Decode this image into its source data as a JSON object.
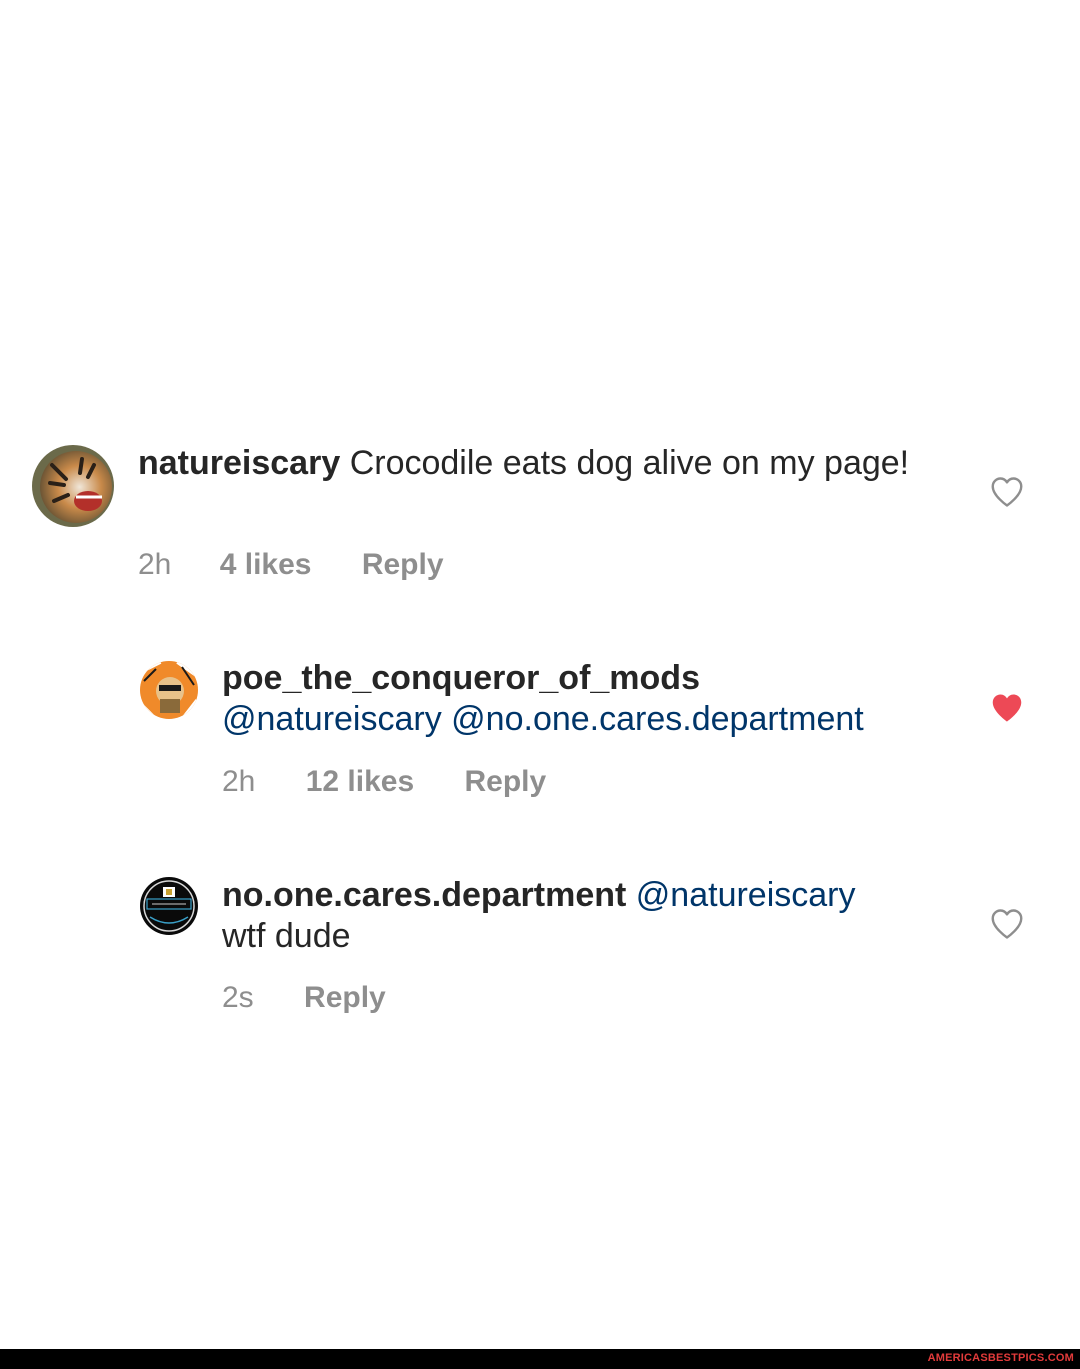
{
  "comments": [
    {
      "avatar": "tiger-avatar",
      "username": "natureiscary",
      "body": "Crocodile eats dog alive on my page!",
      "mentions": [],
      "time": "2h",
      "likes": "4 likes",
      "reply": "Reply",
      "liked": false
    },
    {
      "avatar": "character-avatar",
      "username": "poe_the_conqueror_of_mods",
      "body": "",
      "mentions": [
        "@natureiscary",
        "@no.one.cares.department"
      ],
      "time": "2h",
      "likes": "12 likes",
      "reply": "Reply",
      "liked": true
    },
    {
      "avatar": "department-logo-avatar",
      "username": "no.one.cares.department",
      "mention": "@natureiscary",
      "body": "wtf dude",
      "time": "2s",
      "reply": "Reply",
      "liked": false
    }
  ],
  "colors": {
    "text": "#262626",
    "meta": "#8e8e8e",
    "mention": "#003569",
    "heart_liked": "#ed4956",
    "heart_outline": "#8e8e8e"
  },
  "watermark": "AMERICASBESTPICS.COM"
}
